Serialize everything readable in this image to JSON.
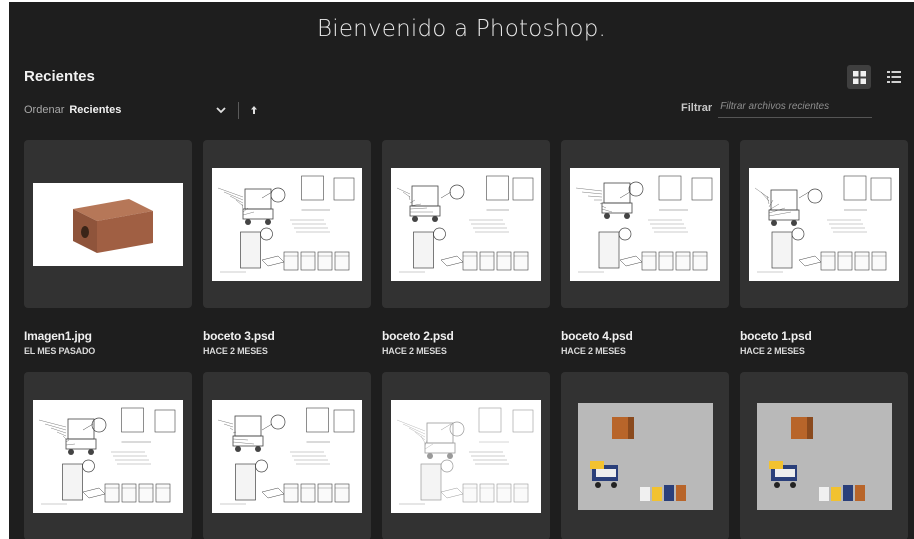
{
  "header": {
    "title": "Bienvenido a Photoshop."
  },
  "section": {
    "title": "Recientes"
  },
  "sort": {
    "label": "Ordenar",
    "value": "Recientes"
  },
  "filter": {
    "label": "Filtrar",
    "placeholder": "Filtrar archivos recientes"
  },
  "view": {
    "active": "grid",
    "icons": [
      "grid-view-icon",
      "list-view-icon"
    ]
  },
  "colors": {
    "background": "#1e1e1e",
    "card": "#323232",
    "text": "#f0f0f0"
  },
  "files": [
    {
      "name": "Imagen1.jpg",
      "date": "EL MES PASADO",
      "kind": "box"
    },
    {
      "name": "boceto 3.psd",
      "date": "HACE 2 MESES",
      "kind": "sketch"
    },
    {
      "name": "boceto 2.psd",
      "date": "HACE 2 MESES",
      "kind": "sketch"
    },
    {
      "name": "boceto 4.psd",
      "date": "HACE 2 MESES",
      "kind": "sketch"
    },
    {
      "name": "boceto 1.psd",
      "date": "HACE 2 MESES",
      "kind": "sketch"
    },
    {
      "name": "",
      "date": "",
      "kind": "sketch"
    },
    {
      "name": "",
      "date": "",
      "kind": "sketch"
    },
    {
      "name": "",
      "date": "",
      "kind": "sketch-light"
    },
    {
      "name": "",
      "date": "",
      "kind": "render"
    },
    {
      "name": "",
      "date": "",
      "kind": "render"
    }
  ]
}
